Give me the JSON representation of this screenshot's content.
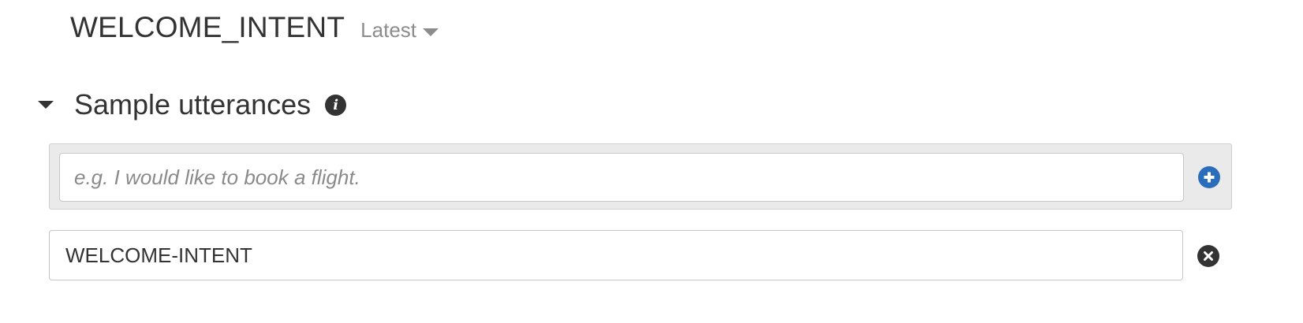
{
  "header": {
    "intent_name": "WELCOME_INTENT",
    "version_label": "Latest",
    "version_icon": "caret-down-icon"
  },
  "sample_utterances": {
    "title": "Sample utterances",
    "toggle_icon": "caret-down-icon",
    "info_icon": "info-icon",
    "info_glyph": "i",
    "new_input": {
      "placeholder": "e.g. I would like to book a flight.",
      "value": ""
    },
    "add_icon": "plus-circle-icon",
    "items": [
      {
        "value": "WELCOME-INTENT",
        "remove_icon": "close-circle-icon"
      }
    ]
  },
  "colors": {
    "text": "#333333",
    "muted": "#8c8c8c",
    "panel_bg": "#eaeaea",
    "accent_blue": "#2a6ebb"
  }
}
